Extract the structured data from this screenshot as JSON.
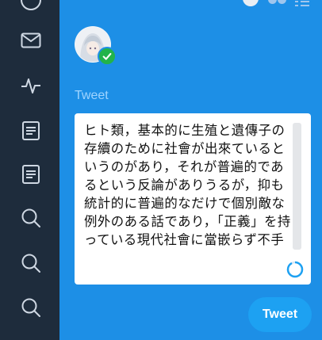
{
  "composer": {
    "label": "Tweet",
    "text": "ヒト類，基本的に生殖と遺傳子の存續のために社會が出來ているというのがあり，それが普遍的であるという反論がありうるが，抑も統計的に普遍的なだけで個別敵な例外のある話であり，「正義」を持っている現代社會に當嵌らず不手"
  },
  "actions": {
    "submit_label": "Tweet"
  },
  "sidebar": {
    "items": [
      {
        "icon": "profile-icon"
      },
      {
        "icon": "mail-icon"
      },
      {
        "icon": "activity-icon"
      },
      {
        "icon": "list-icon"
      },
      {
        "icon": "list-icon"
      },
      {
        "icon": "search-icon"
      },
      {
        "icon": "search-icon"
      },
      {
        "icon": "search-icon"
      }
    ]
  },
  "colors": {
    "background": "#1d8fe6",
    "sidebar": "#1e2c3c",
    "button": "#1da1f2",
    "verified": "#22b34a",
    "label": "#9fd4ff"
  }
}
